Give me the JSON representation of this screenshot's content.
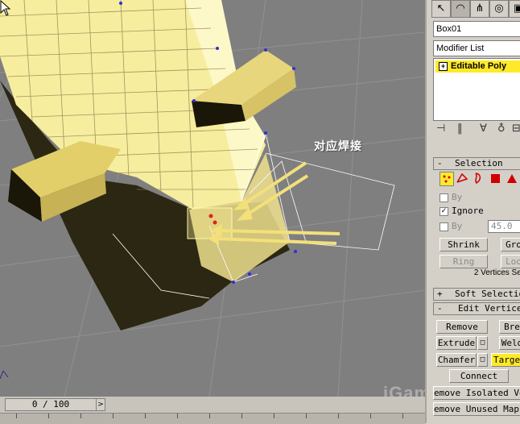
{
  "viewport": {
    "annotation": "对应焊接",
    "background": "#7f7f7f",
    "mesh_color": "#f6e89a"
  },
  "timeline": {
    "frame": "0 / 100",
    "arrow": ">"
  },
  "panel": {
    "tabs": [
      "create-icon",
      "modify-icon",
      "hierarchy-icon",
      "motion-icon",
      "display-icon"
    ],
    "object_name": "Box01",
    "modifier_list": "Modifier List",
    "stack_item": "Editable Poly",
    "selection": {
      "header_sign": "-",
      "title": "Selection",
      "by_label": "By",
      "ignore_label": "Ignore",
      "by_angle_label": "By",
      "angle_value": "45.0",
      "shrink": "Shrink",
      "grow": "Gro",
      "ring": "Ring",
      "loop": "Loo",
      "status": "2 Vertices Sel"
    },
    "soft_selection": {
      "sign": "+",
      "title": "Soft Selection"
    },
    "edit_vertices": {
      "sign": "-",
      "title": "Edit Vertices",
      "remove": "Remove",
      "break": "Bre",
      "extrude": "Extrude",
      "weld": "Weld",
      "chamfer": "Chamfer",
      "target": "Target",
      "connect": "Connect",
      "remove_isolated": "emove Isolated Ve",
      "remove_unused": "emove Unused Map"
    }
  }
}
